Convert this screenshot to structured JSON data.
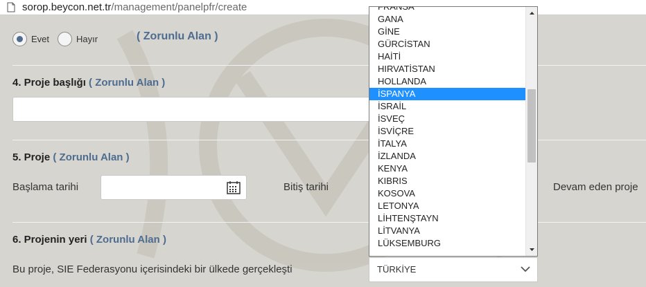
{
  "browser": {
    "url_host": "sorop.beycon.net.tr",
    "url_path": "/management/panelpfr/create"
  },
  "form": {
    "required_tag": "( Zorunlu Alan )",
    "radio_yes": "Evet",
    "radio_no": "Hayır",
    "section4_title": "4. Proje başlığı",
    "section5_title": "5. Proje",
    "start_date_label": "Başlama tarihi",
    "end_date_label": "Bitiş tarihi",
    "ongoing_label": "Devam eden proje",
    "section6_title": "6. Projenin yeri",
    "location_question": "Bu proje, SIE Federasyonu içerisindeki bir ülkede gerçekleşti",
    "country_selected": "TÜRKİYE"
  },
  "country_dropdown": {
    "items": [
      "FRANSA",
      "GANA",
      "GİNE",
      "GÜRCİSTAN",
      "HAİTİ",
      "HIRVATİSTAN",
      "HOLLANDA",
      "İSPANYA",
      "İSRAİL",
      "İSVEÇ",
      "İSVİÇRE",
      "İTALYA",
      "İZLANDA",
      "KENYA",
      "KIBRIS",
      "KOSOVA",
      "LETONYA",
      "LİHTENŞTAYN",
      "LİTVANYA",
      "LÜKSEMBURG"
    ],
    "highlighted": "İSPANYA"
  },
  "colors": {
    "accent": "#4e6c90",
    "highlight": "#1e90ff",
    "background": "#d7d5cf"
  }
}
